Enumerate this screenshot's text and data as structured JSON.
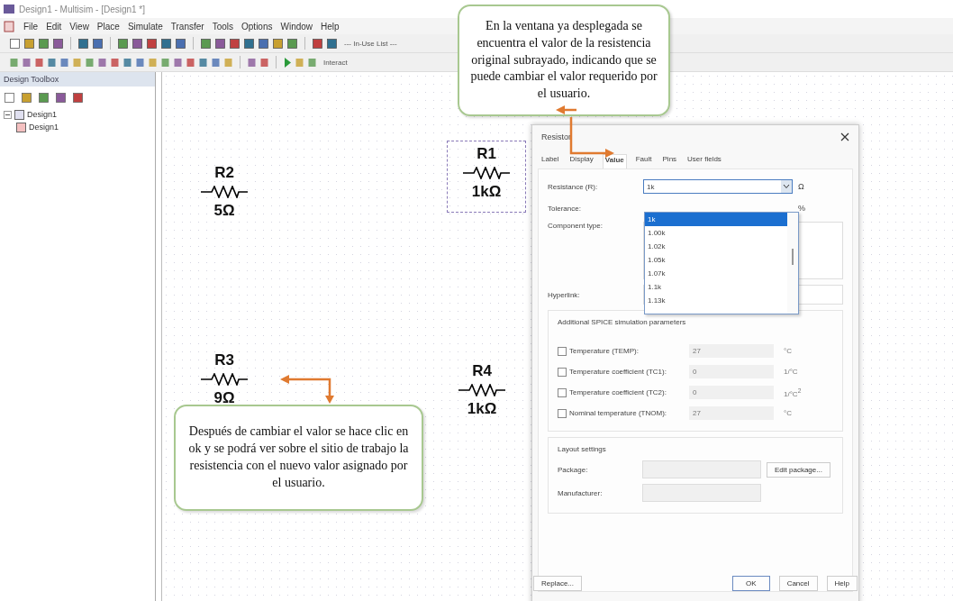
{
  "window": {
    "title": "Design1 - Multisim - [Design1 *]"
  },
  "menu": [
    "File",
    "Edit",
    "View",
    "Place",
    "Simulate",
    "Transfer",
    "Tools",
    "Options",
    "Window",
    "Help"
  ],
  "toolbar": {
    "in_use_list": "--- In-Use List ---",
    "interactive": "Interact"
  },
  "design_toolbox": {
    "title": "Design Toolbox",
    "tree": [
      {
        "label": "Design1",
        "expanded": true,
        "children": [
          {
            "label": "Design1"
          }
        ]
      }
    ]
  },
  "schematic": {
    "components": [
      {
        "label": "R2",
        "value": "5Ω",
        "selected": false
      },
      {
        "label": "R1",
        "value": "1kΩ",
        "selected": true
      },
      {
        "label": "R3",
        "value": "9Ω",
        "selected": false
      },
      {
        "label": "R4",
        "value": "1kΩ",
        "selected": false
      }
    ]
  },
  "callouts": [
    {
      "text": "En la ventana ya desplegada se encuentra el valor de la resistencia original subrayado, indicando que se puede cambiar el valor requerido por el usuario."
    },
    {
      "text": "Después de cambiar el valor se hace clic en ok y se podrá ver sobre el sitio de trabajo la resistencia con el nuevo valor asignado por el usuario."
    }
  ],
  "dialog": {
    "title": "Resistor",
    "tabs": [
      {
        "label": "Label",
        "selected": false
      },
      {
        "label": "Display",
        "selected": false
      },
      {
        "label": "Value",
        "selected": true
      },
      {
        "label": "Fault",
        "selected": false
      },
      {
        "label": "Pins",
        "selected": false
      },
      {
        "label": "User fields",
        "selected": false
      }
    ],
    "resistance": {
      "label": "Resistance (R):",
      "value": "1k",
      "unit": "Ω",
      "options": [
        {
          "label": "1k",
          "selected": true
        },
        {
          "label": "1.00k",
          "selected": false
        },
        {
          "label": "1.02k",
          "selected": false
        },
        {
          "label": "1.05k",
          "selected": false
        },
        {
          "label": "1.07k",
          "selected": false
        },
        {
          "label": "1.1k",
          "selected": false
        },
        {
          "label": "1.13k",
          "selected": false
        }
      ]
    },
    "tolerance": {
      "label": "Tolerance:",
      "unit": "%"
    },
    "component_type": {
      "label": "Component type:"
    },
    "hyperlink": {
      "label": "Hyperlink:"
    },
    "spice": {
      "title": "Additional SPICE simulation parameters",
      "params": [
        {
          "label": "Temperature (TEMP):",
          "checked": false,
          "value": "27",
          "unit": "°C"
        },
        {
          "label": "Temperature coefficient (TC1):",
          "checked": false,
          "value": "0",
          "unit": "1/°C"
        },
        {
          "label": "Temperature coefficient (TC2):",
          "checked": false,
          "value": "0",
          "unit": "1/°C$^{2}$"
        },
        {
          "label": "Nominal temperature (TNOM):",
          "checked": false,
          "value": "27",
          "unit": "°C"
        }
      ]
    },
    "layout": {
      "title": "Layout settings",
      "package_label": "Package:",
      "manufacturer_label": "Manufacturer:",
      "edit_button": "Edit package..."
    },
    "buttons": {
      "left": "Replace...",
      "right": [
        "OK",
        "Cancel",
        "Help"
      ]
    }
  }
}
